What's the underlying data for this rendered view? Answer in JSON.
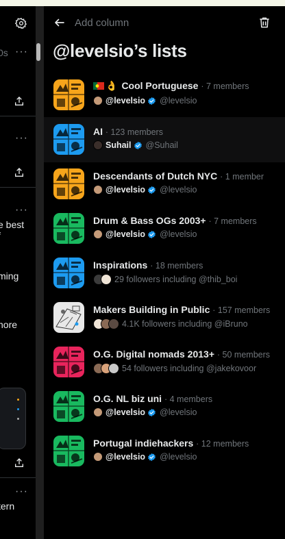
{
  "colors": {
    "background": "#000000",
    "accent": "#1d9bf0",
    "muted": "#71767b",
    "text": "#e7e9ea",
    "divider": "#2f3336"
  },
  "left_column": {
    "fragments": [
      {
        "text": "0s"
      },
      {
        "text": "e best"
      },
      {
        "text": "f"
      },
      {
        "text": "ming"
      },
      {
        "text": "nore"
      },
      {
        "text": "tern"
      }
    ]
  },
  "header": {
    "back_icon": "arrow-left-icon",
    "add_column": "Add column",
    "delete_icon": "trash-icon",
    "title": "@levelsio’s lists"
  },
  "lists": [
    {
      "name": "Cool Portuguese",
      "emoji": [
        "portugal-flag",
        "ok-hand"
      ],
      "meta": "· 7 members",
      "owner": "@levelsio",
      "handle": "@levelsio",
      "verified": true,
      "thumb_color": "#f7a51b",
      "thumb_icon": "crowd-illustration"
    },
    {
      "name": "AI",
      "meta": "· 123 members",
      "owner": "Suhail",
      "handle": "@Suhail",
      "verified": true,
      "thumb_color": "#1d9bf0",
      "thumb_icon": "crowd-illustration"
    },
    {
      "name": "Descendants of Dutch NYC",
      "meta": "· 1 member",
      "owner": "@levelsio",
      "handle": "@levelsio",
      "verified": true,
      "thumb_color": "#f7a51b",
      "thumb_icon": "crowd-illustration"
    },
    {
      "name": "Drum & Bass OGs 2003+",
      "meta": "· 7 members",
      "owner": "@levelsio",
      "handle": "@levelsio",
      "verified": true,
      "thumb_color": "#19b95f",
      "thumb_icon": "crowd-illustration"
    },
    {
      "name": "Inspirations",
      "meta": "· 18 members",
      "followers": "29 followers including @thib_boi",
      "thumb_color": "#1d9bf0",
      "thumb_icon": "crowd-illustration"
    },
    {
      "name": "Makers Building in Public",
      "meta": "· 157 members",
      "followers": "4.1K followers including @iBruno",
      "thumb_color": "#e8e8e8",
      "thumb_icon": "sketch-illustration"
    },
    {
      "name": "O.G. Digital nomads 2013+",
      "meta": "· 50 members",
      "followers": "54 followers including @jakekovoor",
      "thumb_color": "#e8245c",
      "thumb_icon": "crowd-illustration"
    },
    {
      "name": "O.G. NL biz uni",
      "meta": "· 4 members",
      "owner": "@levelsio",
      "handle": "@levelsio",
      "verified": true,
      "thumb_color": "#19b95f",
      "thumb_icon": "crowd-illustration"
    },
    {
      "name": "Portugal indiehackers",
      "meta": "· 12 members",
      "owner": "@levelsio",
      "handle": "@levelsio",
      "verified": true,
      "thumb_color": "#19b95f",
      "thumb_icon": "crowd-illustration"
    }
  ]
}
